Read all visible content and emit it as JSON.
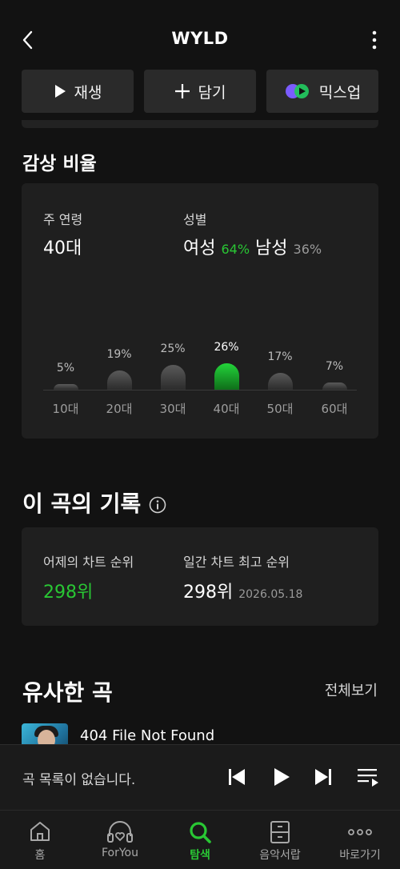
{
  "header": {
    "title": "WYLD"
  },
  "actions": {
    "play": "재생",
    "add": "담기",
    "mixup": "믹스업"
  },
  "listening": {
    "title": "감상 비율",
    "age_label": "주 연령",
    "age_value": "40대",
    "gender_label": "성별",
    "female": "여성",
    "female_pct": "64%",
    "male": "남성",
    "male_pct": "36%",
    "bars": [
      {
        "age": "10대",
        "pct": "5%",
        "value": 5,
        "highlight": false
      },
      {
        "age": "20대",
        "pct": "19%",
        "value": 19,
        "highlight": false
      },
      {
        "age": "30대",
        "pct": "25%",
        "value": 25,
        "highlight": false
      },
      {
        "age": "40대",
        "pct": "26%",
        "value": 26,
        "highlight": true
      },
      {
        "age": "50대",
        "pct": "17%",
        "value": 17,
        "highlight": false
      },
      {
        "age": "60대",
        "pct": "7%",
        "value": 7,
        "highlight": false
      }
    ]
  },
  "records": {
    "title": "이 곡의 기록",
    "yesterday_label": "어제의 차트 순위",
    "yesterday_value": "298위",
    "best_label": "일간 차트 최고 순위",
    "best_value": "298위",
    "best_date": "2026.05.18"
  },
  "similar": {
    "title": "유사한 곡",
    "see_all": "전체보기",
    "first_song": "404 File Not Found"
  },
  "player": {
    "empty_text": "곡 목록이 없습니다."
  },
  "tabs": [
    {
      "label": "홈",
      "icon": "home-icon"
    },
    {
      "label": "ForYou",
      "icon": "foryou-icon"
    },
    {
      "label": "탐색",
      "icon": "search-icon",
      "active": true
    },
    {
      "label": "음악서랍",
      "icon": "drawer-icon"
    },
    {
      "label": "바로가기",
      "icon": "more-dots-icon"
    }
  ],
  "colors": {
    "accent": "#29c734",
    "background": "#121212",
    "card": "#1f1f1f"
  }
}
